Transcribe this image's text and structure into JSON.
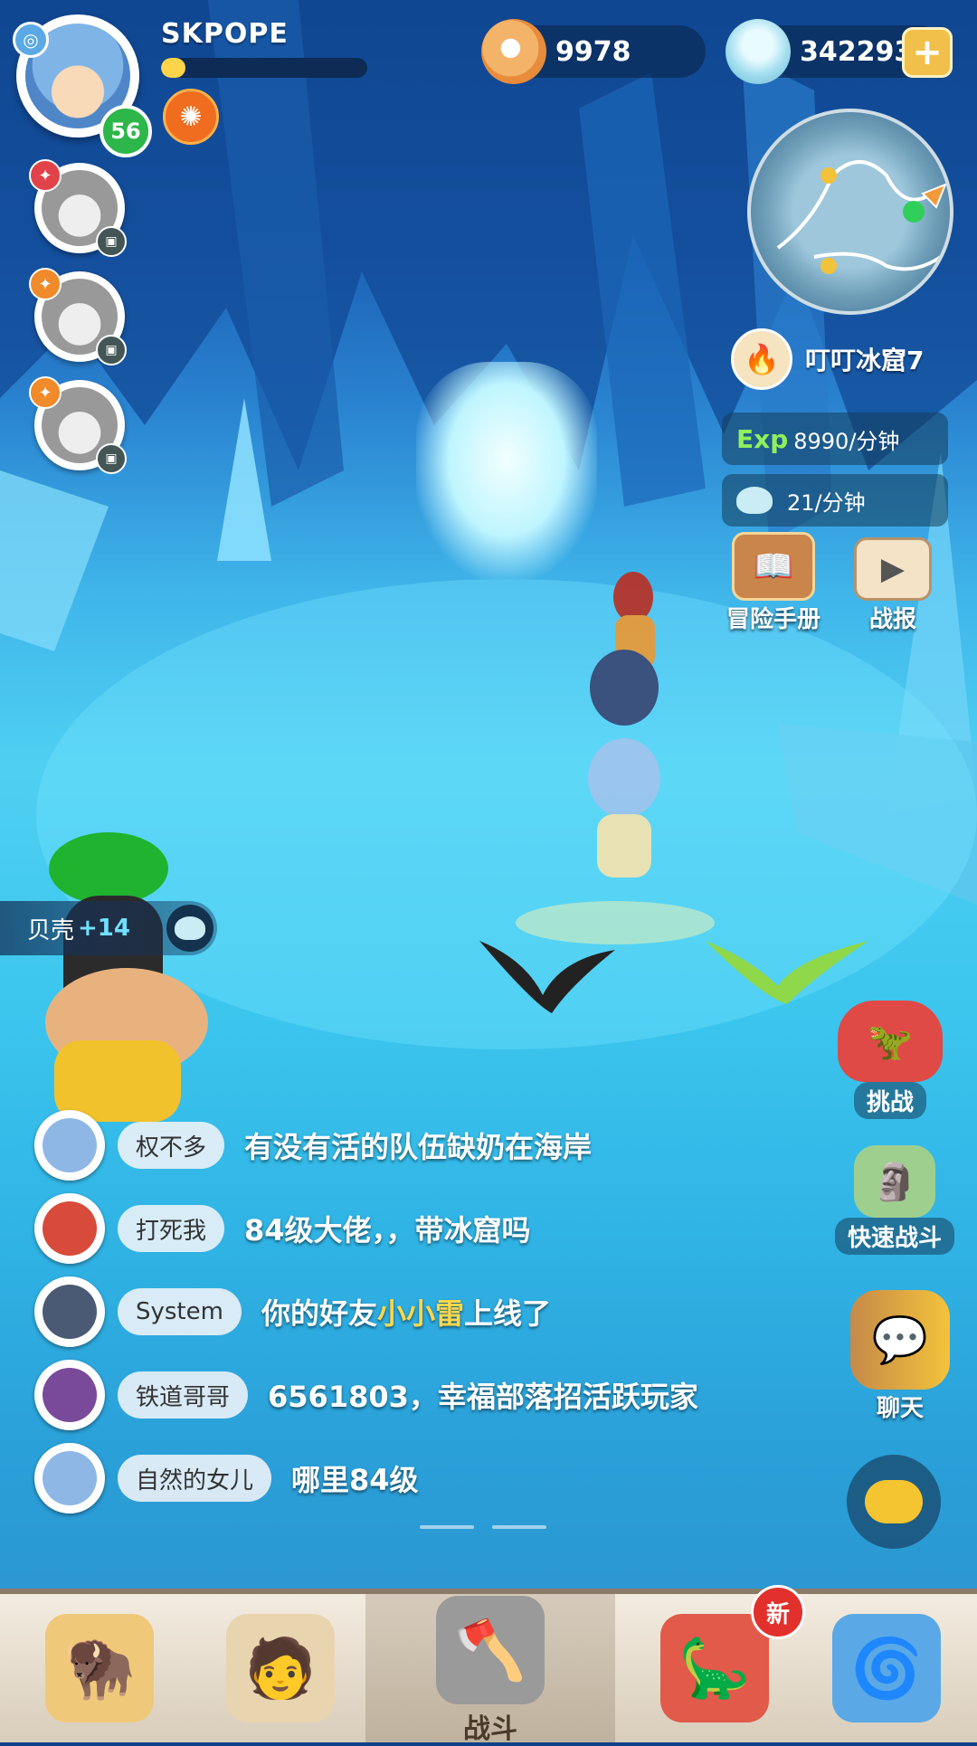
{
  "player": {
    "name": "SKPOPE",
    "level": "56",
    "exp_progress": 0.12
  },
  "currency": {
    "pearls": "9978",
    "shells": "342293"
  },
  "location": {
    "name": "叮叮冰窟7"
  },
  "rates": {
    "exp_tag": "Exp",
    "exp_rate": "8990/分钟",
    "shell_rate": "21/分钟"
  },
  "side_buttons": {
    "handbook": "冒险手册",
    "battle_report": "战报",
    "challenge": "挑战",
    "quick_battle": "快速战斗",
    "chat": "聊天"
  },
  "pickup": {
    "label": "贝壳",
    "amount": "+14"
  },
  "chat": [
    {
      "name": "权不多",
      "msg": "有没有活的队伍缺奶在海岸"
    },
    {
      "name": "打死我",
      "msg": "84级大佬，，带冰窟吗"
    },
    {
      "name": "System",
      "msg_pre": "你的好友",
      "msg_hl": "小小雷",
      "msg_post": "上线了"
    },
    {
      "name": "铁道哥哥",
      "msg": "6561803，幸福部落招活跃玩家"
    },
    {
      "name": "自然的女儿",
      "msg": "哪里84级"
    }
  ],
  "nav": {
    "battle": "战斗",
    "new_badge": "新"
  }
}
